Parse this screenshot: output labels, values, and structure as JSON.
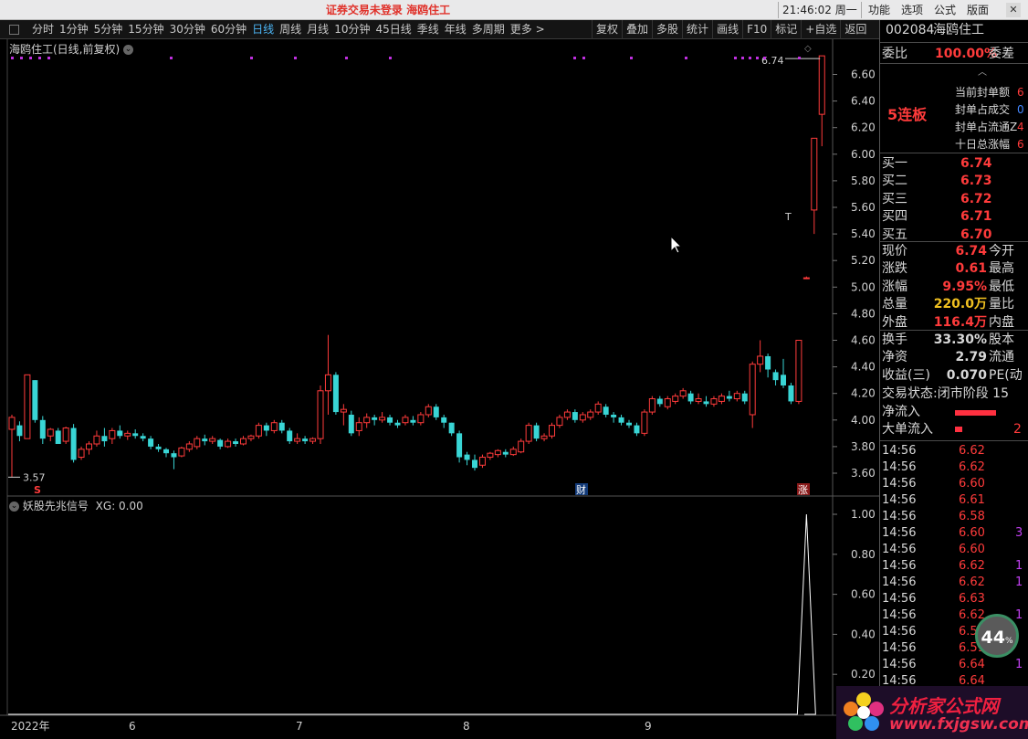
{
  "titlebar": {
    "center_text": "证券交易未登录  海鸥住工",
    "clock": "21:46:02 周一",
    "menu": [
      "功能",
      "选项",
      "公式",
      "版面"
    ],
    "close": "✕"
  },
  "toolbar": {
    "periods": [
      "分时",
      "1分钟",
      "5分钟",
      "15分钟",
      "30分钟",
      "60分钟",
      "日线",
      "周线",
      "月线",
      "10分钟",
      "45日线",
      "季线",
      "年线",
      "多周期",
      "更多 >"
    ],
    "active_period": "日线",
    "tools": [
      "复权",
      "叠加",
      "多股",
      "统计",
      "画线",
      "F10",
      "标记",
      "+自选",
      "返回"
    ]
  },
  "main_chart": {
    "title": "海鸥住工(日线,前复权)",
    "y_ticks": [
      "6.60",
      "6.40",
      "6.20",
      "6.00",
      "5.80",
      "5.60",
      "5.40",
      "5.20",
      "5.00",
      "4.80",
      "4.60",
      "4.40",
      "4.20",
      "4.00",
      "3.80",
      "3.60"
    ],
    "low_label": "3.57",
    "high_label": "6.74",
    "t_marker": "T",
    "markers": {
      "s": "S",
      "cai": "财",
      "zhang": "涨"
    }
  },
  "indicator": {
    "title": "妖股先兆信号",
    "value_label": "XG: 0.00",
    "y_ticks": [
      "1.00",
      "0.80",
      "0.60",
      "0.40",
      "0.20"
    ]
  },
  "x_axis": {
    "labels": [
      "2022年",
      "6",
      "7",
      "8",
      "9"
    ]
  },
  "chart_data": [
    {
      "type": "candlestick",
      "title": "海鸥住工(日线,前复权)",
      "ylim": [
        3.5,
        6.75
      ],
      "up_color": "#ff3b3b",
      "down_color": "#39d5d5",
      "candles": [
        [
          3.93,
          4.02,
          4.04,
          3.57
        ],
        [
          3.96,
          3.88,
          3.99,
          3.84
        ],
        [
          3.86,
          4.34,
          4.34,
          3.86
        ],
        [
          4.3,
          4.0,
          4.3,
          3.98
        ],
        [
          4.0,
          3.86,
          4.03,
          3.82
        ],
        [
          3.88,
          3.93,
          3.94,
          3.84
        ],
        [
          3.92,
          3.82,
          3.94,
          3.82
        ],
        [
          3.84,
          3.94,
          3.95,
          3.82
        ],
        [
          3.94,
          3.7,
          3.97,
          3.68
        ],
        [
          3.72,
          3.78,
          3.8,
          3.7
        ],
        [
          3.78,
          3.82,
          3.84,
          3.74
        ],
        [
          3.82,
          3.88,
          3.92,
          3.8
        ],
        [
          3.88,
          3.84,
          3.94,
          3.8
        ],
        [
          3.86,
          3.92,
          3.94,
          3.82
        ],
        [
          3.92,
          3.88,
          3.96,
          3.86
        ],
        [
          3.88,
          3.9,
          3.92,
          3.85
        ],
        [
          3.9,
          3.88,
          3.93,
          3.86
        ],
        [
          3.88,
          3.86,
          3.9,
          3.84
        ],
        [
          3.86,
          3.8,
          3.88,
          3.78
        ],
        [
          3.8,
          3.78,
          3.82,
          3.76
        ],
        [
          3.78,
          3.75,
          3.79,
          3.72
        ],
        [
          3.75,
          3.72,
          3.77,
          3.63
        ],
        [
          3.73,
          3.79,
          3.8,
          3.72
        ],
        [
          3.78,
          3.82,
          3.84,
          3.76
        ],
        [
          3.8,
          3.86,
          3.88,
          3.78
        ],
        [
          3.86,
          3.84,
          3.89,
          3.81
        ],
        [
          3.84,
          3.86,
          3.88,
          3.82
        ],
        [
          3.85,
          3.8,
          3.86,
          3.78
        ],
        [
          3.8,
          3.84,
          3.86,
          3.79
        ],
        [
          3.84,
          3.82,
          3.86,
          3.8
        ],
        [
          3.82,
          3.86,
          3.88,
          3.81
        ],
        [
          3.86,
          3.88,
          3.89,
          3.84
        ],
        [
          3.88,
          3.96,
          3.98,
          3.86
        ],
        [
          3.96,
          3.92,
          3.98,
          3.88
        ],
        [
          3.92,
          3.98,
          4.0,
          3.9
        ],
        [
          3.98,
          3.92,
          4.0,
          3.9
        ],
        [
          3.92,
          3.84,
          3.94,
          3.82
        ],
        [
          3.84,
          3.86,
          3.9,
          3.82
        ],
        [
          3.86,
          3.84,
          3.88,
          3.82
        ],
        [
          3.84,
          3.86,
          3.87,
          3.82
        ],
        [
          3.86,
          4.22,
          4.26,
          3.82
        ],
        [
          4.22,
          4.34,
          4.64,
          4.04
        ],
        [
          4.34,
          4.06,
          4.36,
          4.04
        ],
        [
          4.06,
          4.08,
          4.12,
          3.96
        ],
        [
          4.04,
          3.9,
          4.07,
          3.88
        ],
        [
          3.92,
          3.98,
          4.02,
          3.88
        ],
        [
          3.98,
          4.02,
          4.05,
          3.94
        ],
        [
          4.02,
          4.0,
          4.04,
          3.96
        ],
        [
          4.0,
          4.02,
          4.06,
          3.98
        ],
        [
          4.02,
          3.98,
          4.04,
          3.96
        ],
        [
          3.98,
          3.96,
          4.0,
          3.94
        ],
        [
          3.98,
          4.02,
          4.04,
          3.96
        ],
        [
          4.0,
          3.98,
          4.03,
          3.96
        ],
        [
          3.98,
          4.04,
          4.06,
          3.96
        ],
        [
          4.04,
          4.1,
          4.12,
          4.02
        ],
        [
          4.1,
          4.02,
          4.12,
          4.0
        ],
        [
          4.02,
          3.98,
          4.04,
          3.94
        ],
        [
          3.98,
          3.9,
          3.98,
          3.88
        ],
        [
          3.9,
          3.72,
          3.92,
          3.68
        ],
        [
          3.74,
          3.7,
          3.76,
          3.66
        ],
        [
          3.7,
          3.64,
          3.74,
          3.62
        ],
        [
          3.66,
          3.72,
          3.74,
          3.64
        ],
        [
          3.72,
          3.75,
          3.76,
          3.7
        ],
        [
          3.74,
          3.77,
          3.78,
          3.72
        ],
        [
          3.76,
          3.74,
          3.78,
          3.72
        ],
        [
          3.74,
          3.78,
          3.8,
          3.73
        ],
        [
          3.76,
          3.84,
          3.86,
          3.75
        ],
        [
          3.84,
          3.96,
          3.98,
          3.82
        ],
        [
          3.96,
          3.86,
          3.98,
          3.84
        ],
        [
          3.86,
          3.88,
          3.9,
          3.84
        ],
        [
          3.88,
          3.96,
          3.98,
          3.86
        ],
        [
          3.96,
          4.02,
          4.04,
          3.94
        ],
        [
          4.02,
          4.06,
          4.08,
          4.0
        ],
        [
          4.06,
          4.0,
          4.08,
          3.98
        ],
        [
          4.0,
          4.04,
          4.06,
          3.98
        ],
        [
          4.02,
          4.06,
          4.08,
          4.0
        ],
        [
          4.06,
          4.12,
          4.14,
          4.04
        ],
        [
          4.1,
          4.04,
          4.12,
          4.02
        ],
        [
          4.04,
          4.02,
          4.06,
          3.98
        ],
        [
          4.02,
          3.98,
          4.04,
          3.96
        ],
        [
          3.98,
          3.96,
          4.0,
          3.94
        ],
        [
          3.96,
          3.9,
          3.98,
          3.88
        ],
        [
          3.9,
          4.06,
          4.08,
          3.88
        ],
        [
          4.06,
          4.16,
          4.18,
          4.04
        ],
        [
          4.16,
          4.12,
          4.18,
          4.1
        ],
        [
          4.1,
          4.16,
          4.18,
          4.08
        ],
        [
          4.14,
          4.18,
          4.2,
          4.12
        ],
        [
          4.18,
          4.22,
          4.24,
          4.16
        ],
        [
          4.2,
          4.14,
          4.22,
          4.12
        ],
        [
          4.14,
          4.16,
          4.2,
          4.12
        ],
        [
          4.14,
          4.12,
          4.18,
          4.1
        ],
        [
          4.12,
          4.16,
          4.18,
          4.1
        ],
        [
          4.14,
          4.18,
          4.2,
          4.12
        ],
        [
          4.18,
          4.16,
          4.22,
          4.14
        ],
        [
          4.16,
          4.2,
          4.22,
          4.14
        ],
        [
          4.2,
          4.14,
          4.22,
          4.12
        ],
        [
          4.04,
          4.42,
          4.44,
          3.94
        ],
        [
          4.42,
          4.48,
          4.6,
          4.36
        ],
        [
          4.48,
          4.38,
          4.5,
          4.32
        ],
        [
          4.36,
          4.3,
          4.38,
          4.26
        ],
        [
          4.34,
          4.26,
          4.46,
          4.24
        ],
        [
          4.26,
          4.14,
          4.28,
          4.12
        ],
        [
          4.14,
          4.6,
          4.6,
          4.12
        ],
        [
          5.07,
          5.07,
          5.08,
          5.06
        ],
        [
          5.58,
          6.12,
          6.12,
          5.4
        ],
        [
          6.3,
          6.74,
          6.74,
          6.06
        ]
      ]
    },
    {
      "type": "line",
      "title": "妖股先兆信号",
      "ylim": [
        0,
        1.0
      ],
      "signal_index": 103,
      "line_color": "#ffffff"
    }
  ],
  "quote": {
    "code": "002084",
    "name": "海鸥住工",
    "weibi_label": "委比",
    "weibi": "100.00%",
    "weicha_label": "委差",
    "board_badge": "5连板",
    "seal_info": [
      {
        "label": "当前封单额",
        "value": "6"
      },
      {
        "label": "封单占成交",
        "value": "0"
      },
      {
        "label": "封单占流通Z",
        "value": "4"
      },
      {
        "label": "十日总涨幅",
        "value": "6"
      }
    ],
    "bids": [
      {
        "label": "买一",
        "price": "6.74"
      },
      {
        "label": "买二",
        "price": "6.73"
      },
      {
        "label": "买三",
        "price": "6.72"
      },
      {
        "label": "买四",
        "price": "6.71"
      },
      {
        "label": "买五",
        "price": "6.70"
      }
    ],
    "stats": [
      {
        "label": "现价",
        "value": "6.74",
        "right": "今开",
        "color": "red"
      },
      {
        "label": "涨跌",
        "value": "0.61",
        "right": "最高",
        "color": "red"
      },
      {
        "label": "涨幅",
        "value": "9.95%",
        "right": "最低",
        "color": "red"
      },
      {
        "label": "总量",
        "value": "220.0万",
        "right": "量比",
        "color": "yel"
      },
      {
        "label": "外盘",
        "value": "116.4万",
        "right": "内盘",
        "color": "red"
      },
      {
        "label": "换手",
        "value": "33.30%",
        "right": "股本",
        "color": "wht"
      },
      {
        "label": "净资",
        "value": "2.79",
        "right": "流通",
        "color": "wht"
      },
      {
        "label": "收益(三)",
        "value": "0.070",
        "right": "PE(动",
        "color": "wht"
      }
    ],
    "trade_status": "交易状态:闭市阶段 15",
    "net_inflow_label": "净流入",
    "big_inflow_label": "大单流入",
    "big_inflow_value": "2",
    "ticks": [
      {
        "time": "14:56",
        "price": "6.62",
        "vol": ""
      },
      {
        "time": "14:56",
        "price": "6.62",
        "vol": ""
      },
      {
        "time": "14:56",
        "price": "6.60",
        "vol": ""
      },
      {
        "time": "14:56",
        "price": "6.61",
        "vol": ""
      },
      {
        "time": "14:56",
        "price": "6.58",
        "vol": ""
      },
      {
        "time": "14:56",
        "price": "6.60",
        "vol": "3"
      },
      {
        "time": "14:56",
        "price": "6.60",
        "vol": ""
      },
      {
        "time": "14:56",
        "price": "6.62",
        "vol": "1"
      },
      {
        "time": "14:56",
        "price": "6.62",
        "vol": "1"
      },
      {
        "time": "14:56",
        "price": "6.63",
        "vol": ""
      },
      {
        "time": "14:56",
        "price": "6.62",
        "vol": "1"
      },
      {
        "time": "14:56",
        "price": "6.59",
        "vol": ""
      },
      {
        "time": "14:56",
        "price": "6.59",
        "vol": ""
      },
      {
        "time": "14:56",
        "price": "6.64",
        "vol": "1"
      },
      {
        "time": "14:56",
        "price": "6.64",
        "vol": ""
      }
    ]
  },
  "gauge": {
    "value": "44",
    "unit": "%"
  },
  "watermark": {
    "line1": "分析家公式网",
    "line2": "www.fxjgsw.com"
  }
}
